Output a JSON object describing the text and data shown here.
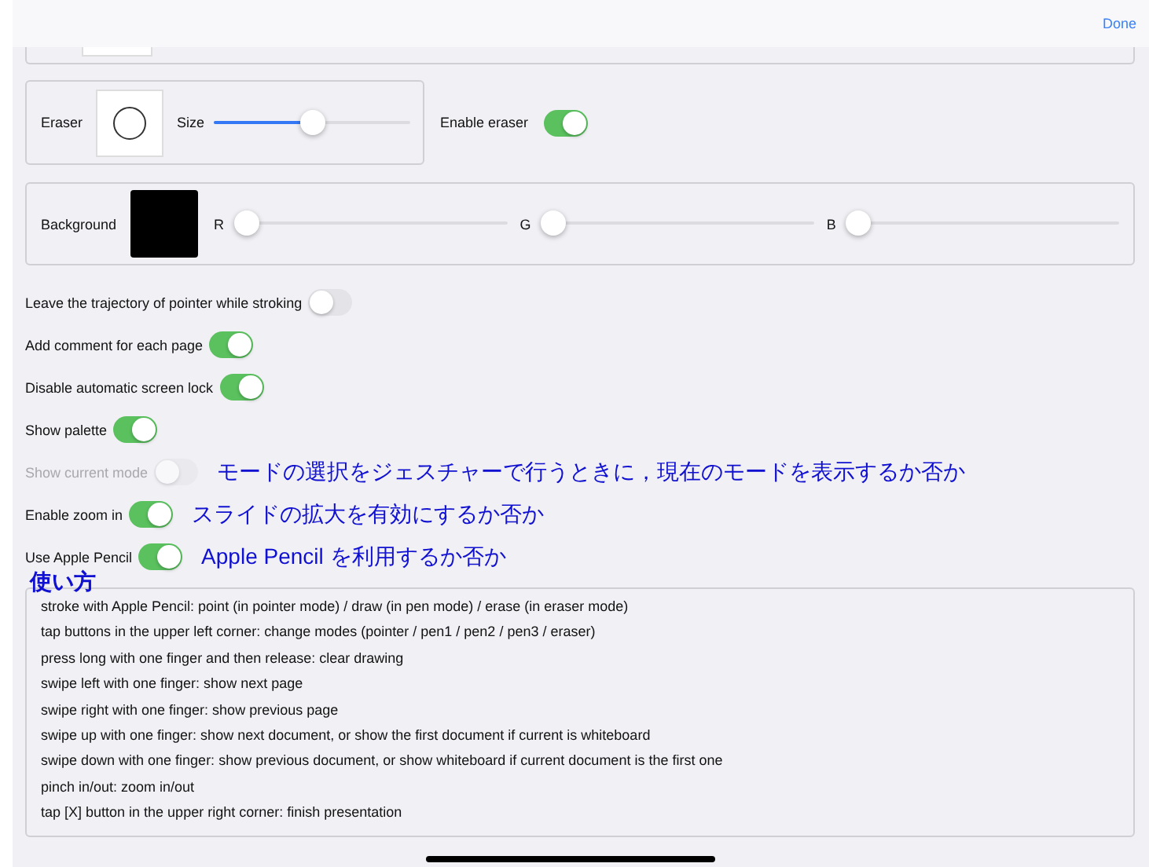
{
  "nav": {
    "done": "Done"
  },
  "eraser": {
    "label": "Eraser",
    "size": {
      "label": "Size",
      "level": 0.5
    },
    "enable": {
      "label": "Enable eraser",
      "on": true
    }
  },
  "background": {
    "label": "Background",
    "channels": [
      {
        "label": "R",
        "level": 0
      },
      {
        "label": "G",
        "level": 0
      },
      {
        "label": "B",
        "level": 0
      }
    ]
  },
  "settings": [
    {
      "label": "Leave the trajectory of pointer while stroking",
      "on": false,
      "disabled": false
    },
    {
      "label": "Add comment for each page",
      "on": true,
      "disabled": false
    },
    {
      "label": "Disable automatic screen lock",
      "on": true,
      "disabled": false
    },
    {
      "label": "Show palette",
      "on": true,
      "disabled": false
    },
    {
      "label": "Show current mode",
      "on": false,
      "disabled": true,
      "note": "モードの選択をジェスチャーで行うときに，現在のモードを表示するか否か"
    },
    {
      "label": "Enable zoom in",
      "on": true,
      "disabled": false,
      "note": "スライドの拡大を有効にするか否か"
    },
    {
      "label": "Use Apple Pencil",
      "on": true,
      "disabled": false,
      "note": "Apple Pencil を利用するか否か"
    }
  ],
  "usage": {
    "title": "使い方",
    "lines": [
      "stroke with Apple Pencil: point (in pointer mode) / draw (in pen mode) / erase (in eraser mode)",
      "tap buttons in the upper left corner: change modes (pointer / pen1 / pen2 / pen3 / eraser)",
      "press long with one finger and then release: clear drawing",
      "swipe left with one finger: show next page",
      "swipe right with one finger: show previous page",
      "swipe up with one finger: show next document, or show the first document if current is whiteboard",
      "swipe down with one finger: show previous document, or show whiteboard if current document is the first one",
      "pinch in/out: zoom in/out",
      "tap [X] button in the upper right corner: finish presentation"
    ]
  }
}
